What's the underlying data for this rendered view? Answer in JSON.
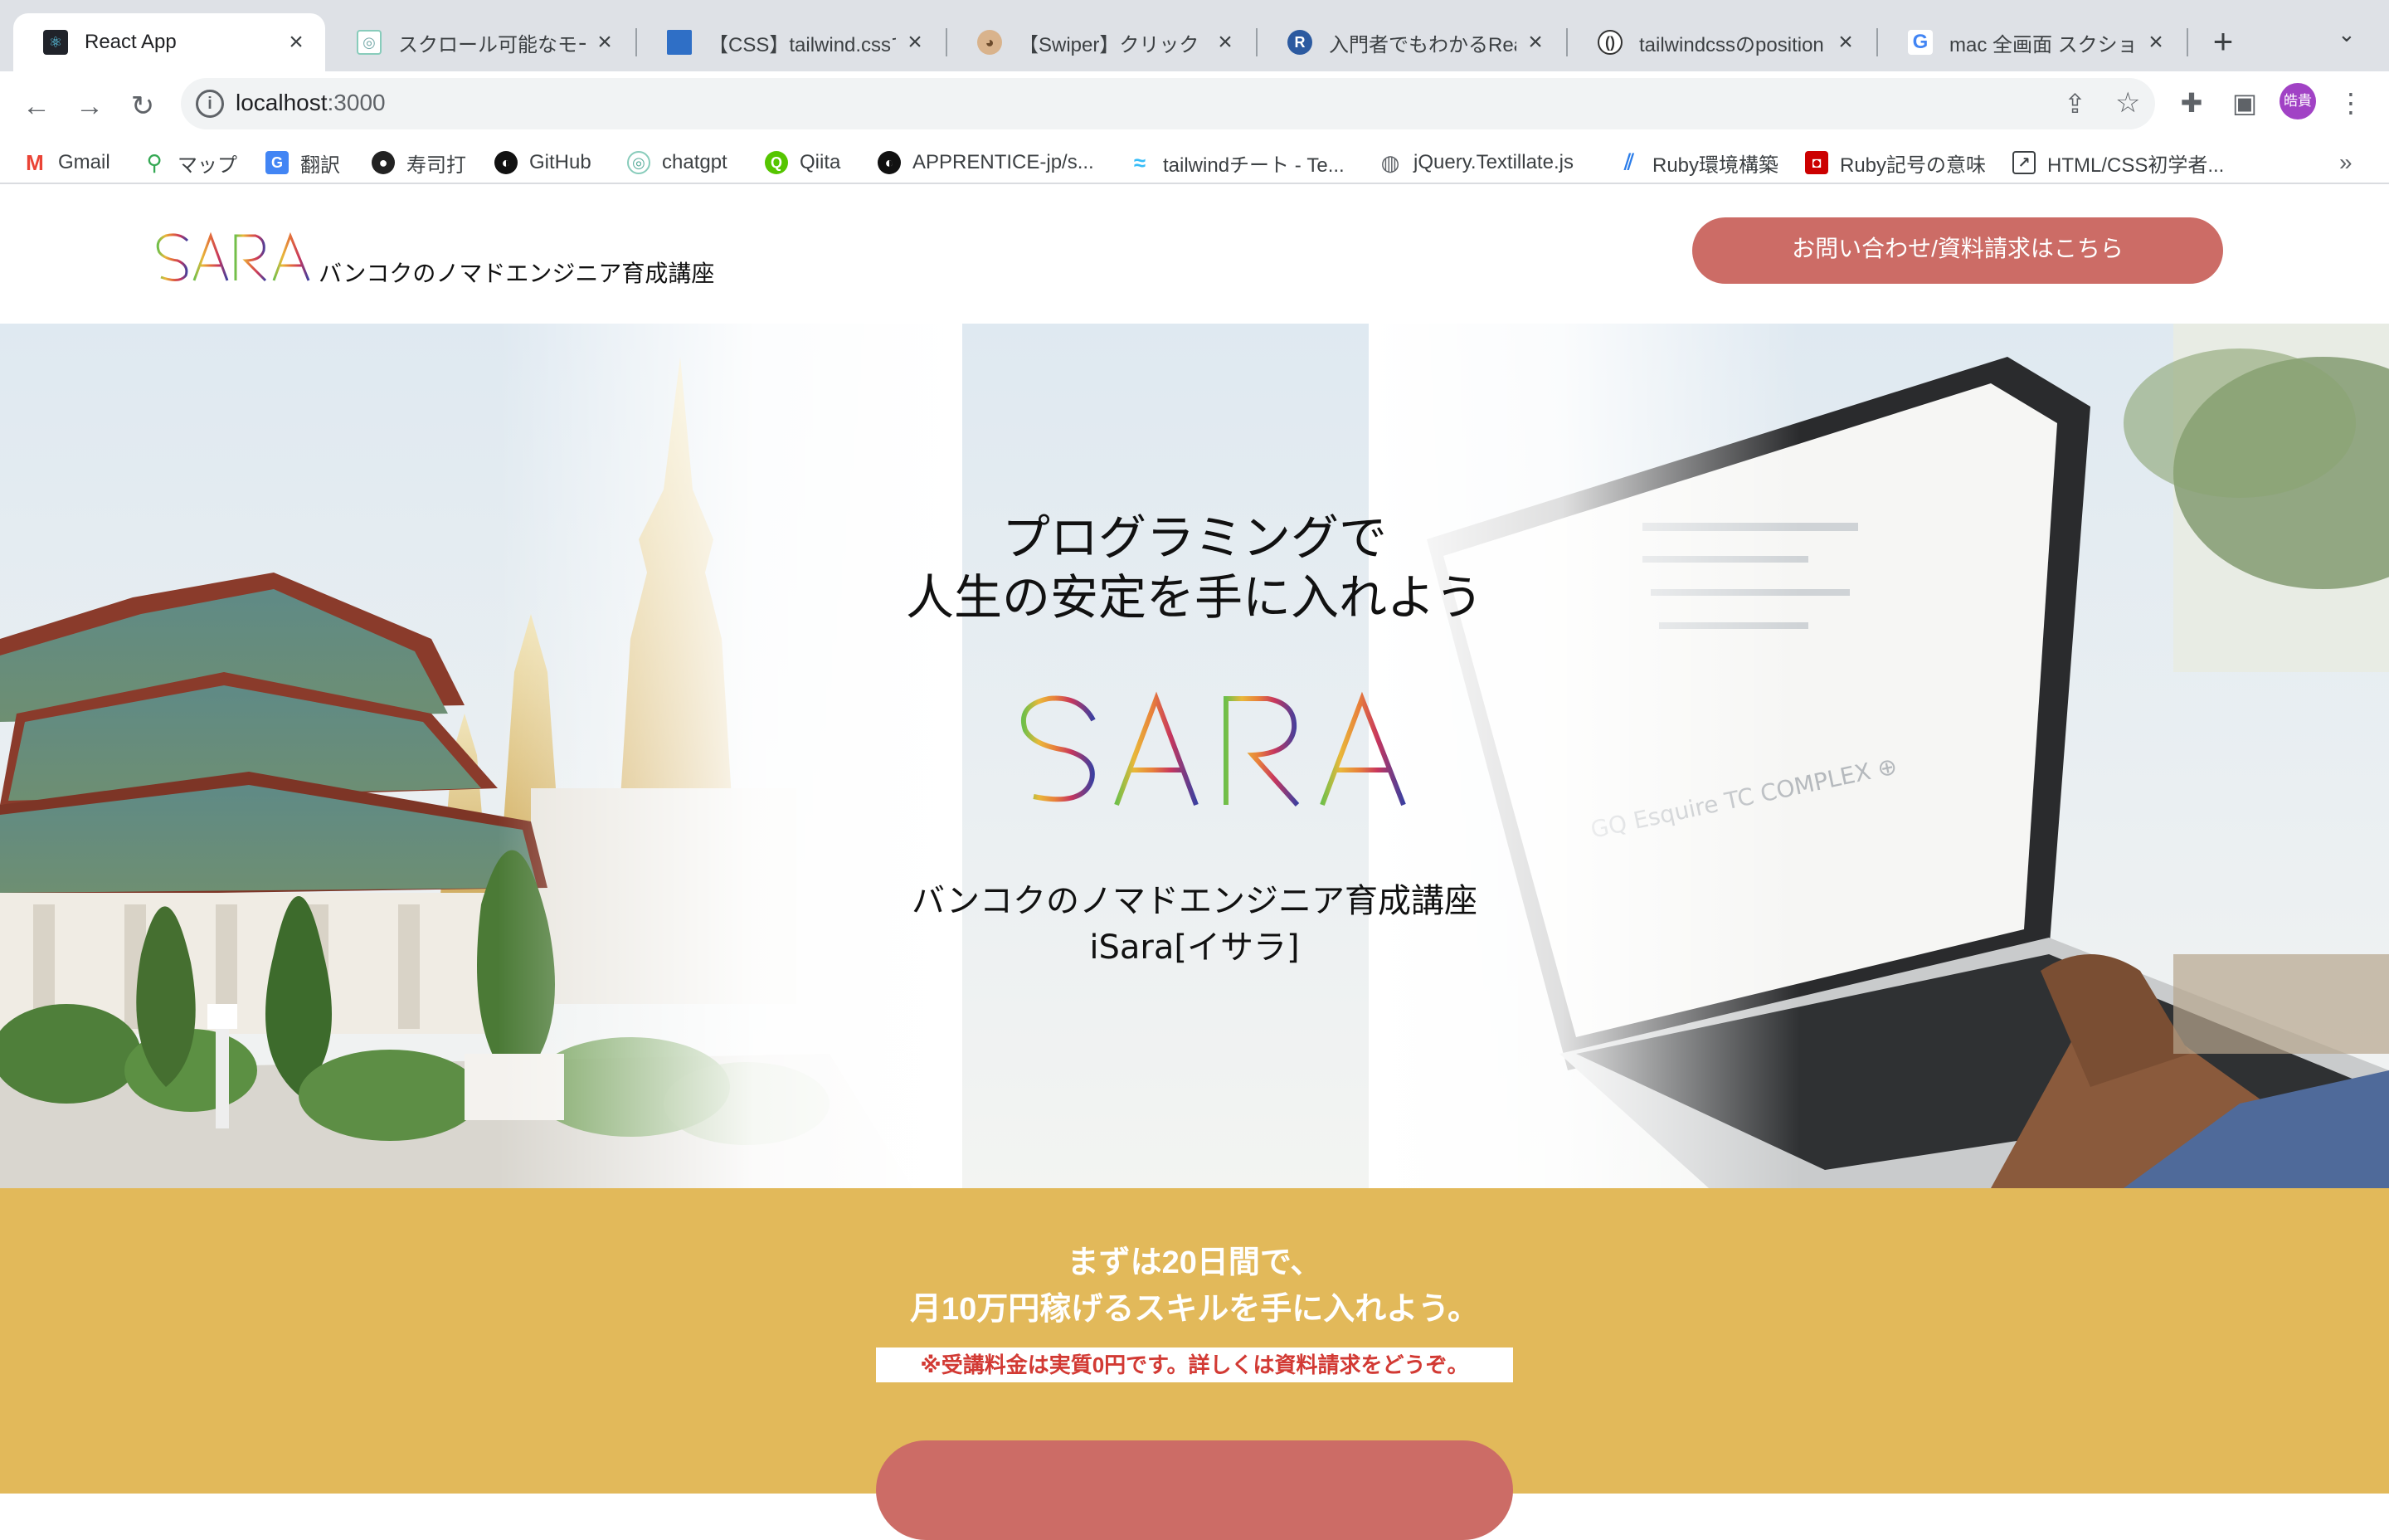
{
  "browser": {
    "tabs": [
      {
        "title": "React App",
        "icon": "react-icon",
        "active": true
      },
      {
        "title": "スクロール可能なモーダ",
        "icon": "chatgpt-icon"
      },
      {
        "title": "【CSS】tailwind.cssで",
        "icon": "blue-square-icon"
      },
      {
        "title": "【Swiper】クリック・フ",
        "icon": "blog-avatar-icon"
      },
      {
        "title": "入門者でもわかるReact",
        "icon": "r-logo-icon"
      },
      {
        "title": "tailwindcssのposition",
        "icon": "qiita-icon"
      },
      {
        "title": "mac 全画面 スクショ - G",
        "icon": "google-icon"
      }
    ],
    "url_host": "localhost",
    "url_port": ":3000",
    "profile_label": "皓貴",
    "bookmarks": [
      {
        "label": "Gmail",
        "icon": "gmail-icon"
      },
      {
        "label": "マップ",
        "icon": "maps-icon"
      },
      {
        "label": "翻訳",
        "icon": "translate-icon"
      },
      {
        "label": "寿司打",
        "icon": "sushi-icon"
      },
      {
        "label": "GitHub",
        "icon": "github-icon"
      },
      {
        "label": "chatgpt",
        "icon": "chatgpt-icon"
      },
      {
        "label": "Qiita",
        "icon": "qiita-icon"
      },
      {
        "label": "APPRENTICE-jp/s...",
        "icon": "github-icon"
      },
      {
        "label": "tailwindチート - Te...",
        "icon": "tailwind-icon"
      },
      {
        "label": "jQuery.Textillate.js",
        "icon": "globe-icon"
      },
      {
        "label": "Ruby環境構築",
        "icon": "ruby-blog-icon"
      },
      {
        "label": "Ruby記号の意味",
        "icon": "ruby-book-icon"
      },
      {
        "label": "HTML/CSS初学者...",
        "icon": "external-link-icon"
      }
    ]
  },
  "header": {
    "logo_text": "iSARA",
    "tagline": "バンコクのノマドエンジニア育成講座",
    "cta_label": "お問い合わせ/資料請求はこちら"
  },
  "hero": {
    "title_line1": "プログラミングで",
    "title_line2": "人生の安定を手に入れよう",
    "logo_text": "iSARA",
    "subtitle_line1": "バンコクのノマドエンジニア育成講座",
    "subtitle_line2": "iSara[イサラ]"
  },
  "promo": {
    "title_line1": "まずは20日間で、",
    "title_line2": "月10万円稼げるスキルを手に入れよう。",
    "note": "※受講料金は実質0円です。詳しくは資料請求をどうぞ。"
  },
  "colors": {
    "accent": "#cc6c66",
    "promo_bg": "#e2b95a",
    "note_red": "#d23a34"
  }
}
